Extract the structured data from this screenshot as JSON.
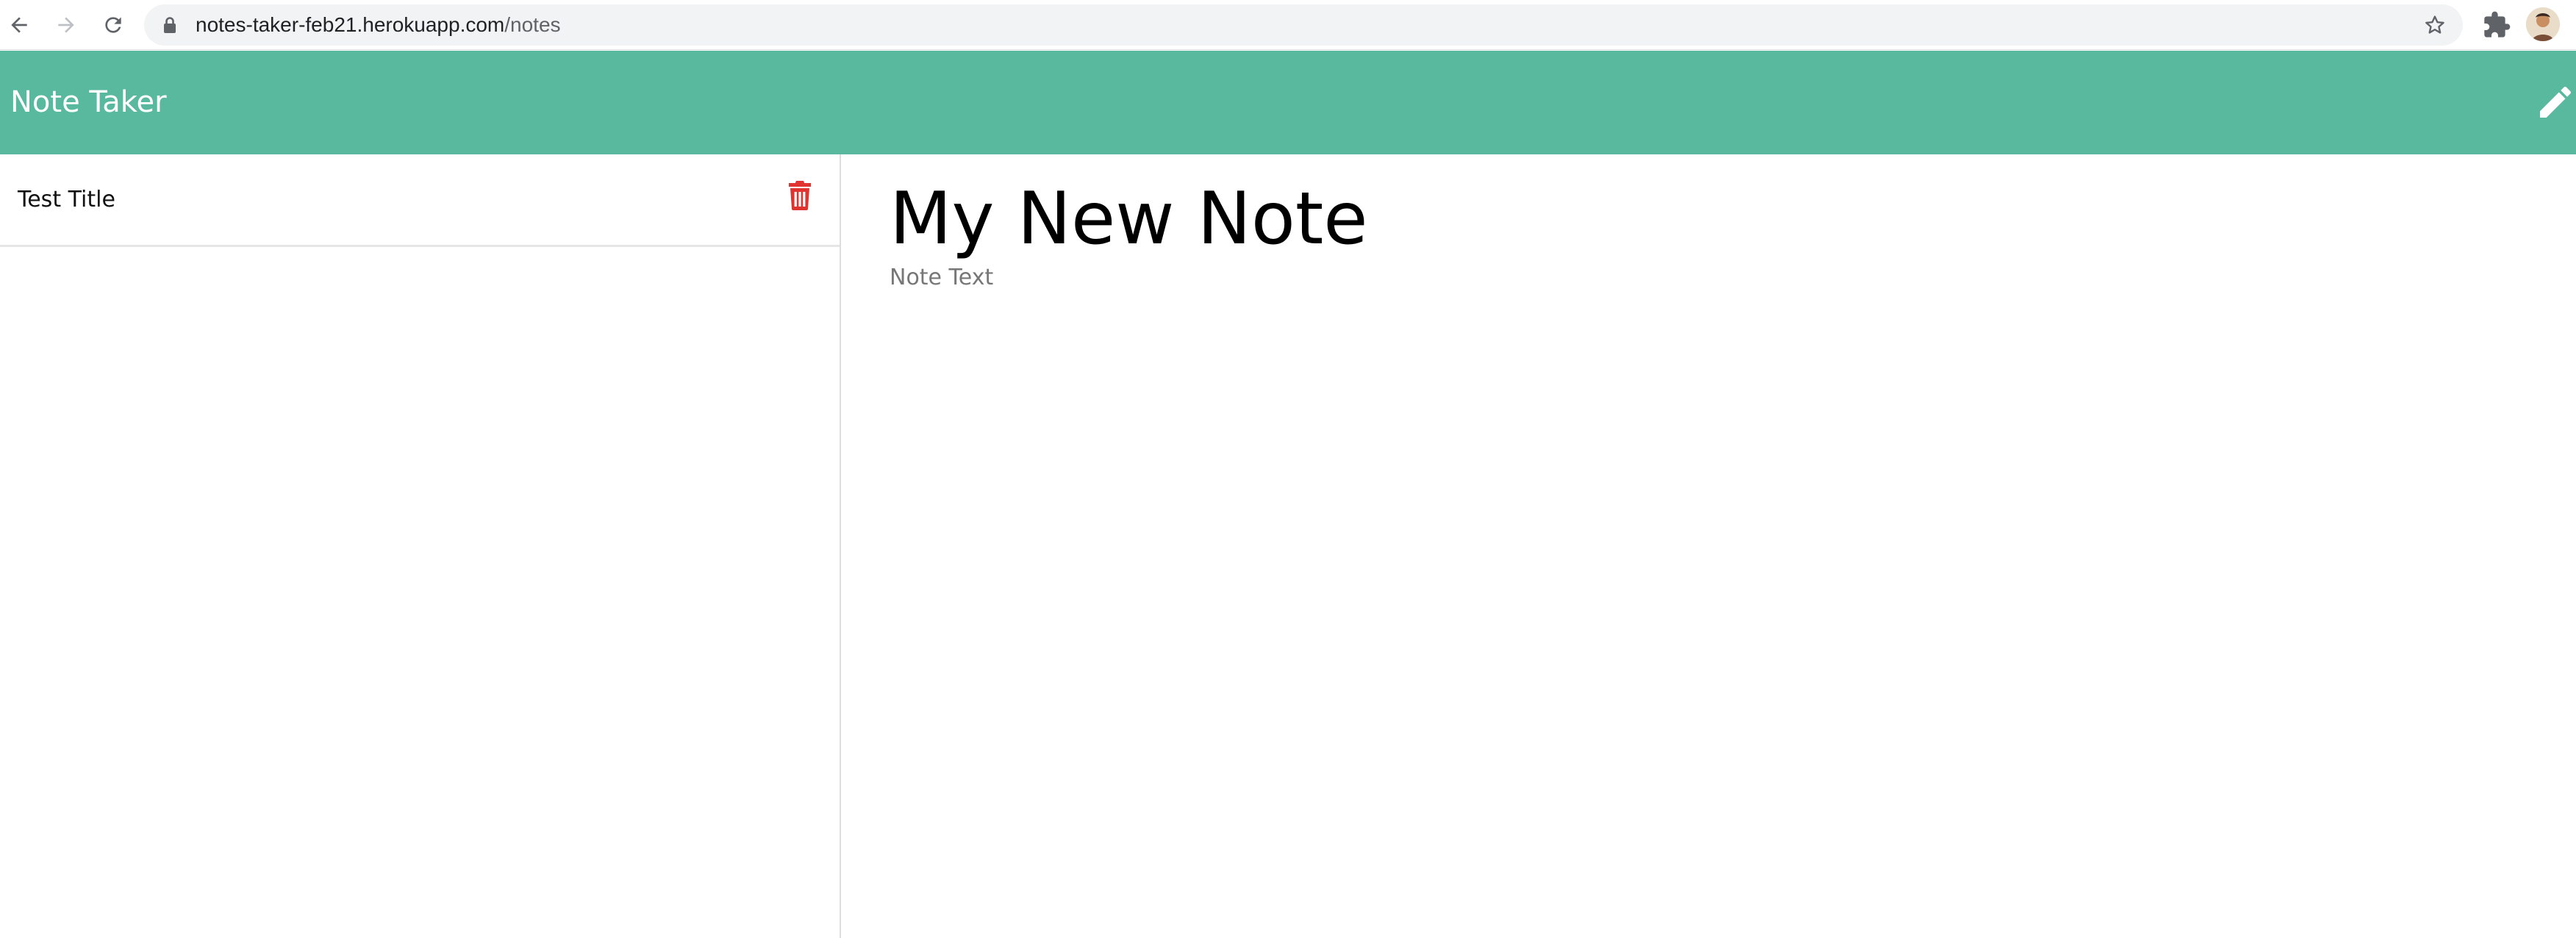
{
  "browser": {
    "url_host": "notes-taker-feb21.herokuapp.com",
    "url_path": "/notes",
    "icons": [
      "back-icon",
      "forward-icon",
      "reload-icon",
      "lock-icon",
      "star-icon",
      "extensions-icon",
      "avatar"
    ]
  },
  "header": {
    "title": "Note Taker",
    "new_note_icon": "pencil-icon",
    "background_color": "#58b99f"
  },
  "sidebar": {
    "notes": [
      {
        "title": "Test Title",
        "delete_icon": "trash-icon",
        "delete_color": "#e0322f"
      }
    ]
  },
  "editor": {
    "title_placeholder": "My New Note",
    "text_placeholder": "Note Text"
  }
}
